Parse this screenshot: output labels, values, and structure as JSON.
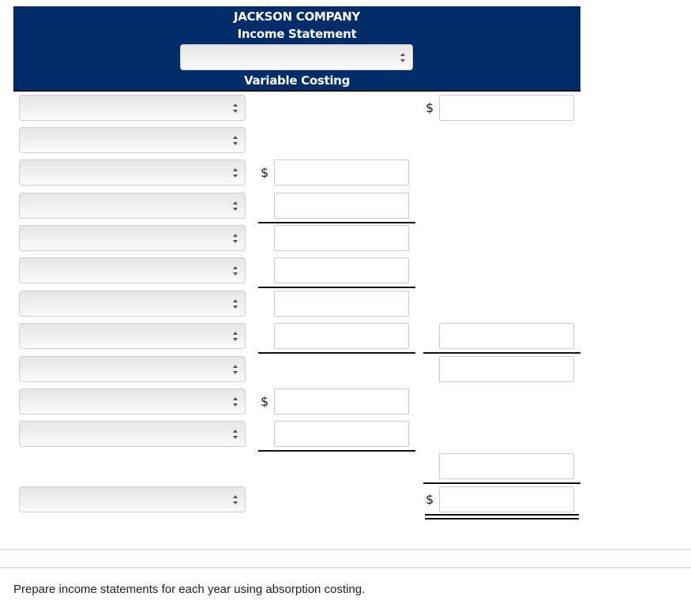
{
  "header": {
    "company": "JACKSON COMPANY",
    "statement": "Income Statement",
    "period_select": {
      "selected": ""
    },
    "method": "Variable Costing"
  },
  "currency_symbol": "$",
  "rows": [
    {
      "label_select": "",
      "mid": null,
      "right": "",
      "right_dollar": true
    },
    {
      "label_select": "",
      "mid": null,
      "right": null
    },
    {
      "label_select": "",
      "mid": "",
      "mid_dollar": true,
      "right": null
    },
    {
      "label_select": "",
      "mid": "",
      "right": null,
      "mid_underline": true
    },
    {
      "label_select": "",
      "mid": "",
      "right": null
    },
    {
      "label_select": "",
      "mid": "",
      "right": null,
      "mid_underline": true
    },
    {
      "label_select": "",
      "mid": "",
      "right": null
    },
    {
      "label_select": "",
      "mid": "",
      "right": "",
      "mid_underline": true,
      "right_underline": true
    },
    {
      "label_select": "",
      "mid": null,
      "right": ""
    },
    {
      "label_select": "",
      "mid": "",
      "mid_dollar": true,
      "right": null
    },
    {
      "label_select": "",
      "mid": "",
      "right": null,
      "mid_underline": true
    },
    {
      "label_select": null,
      "mid": null,
      "right": "",
      "right_underline": true
    },
    {
      "label_select": "",
      "mid": null,
      "right": "",
      "right_dollar": true,
      "right_double_underline": true
    }
  ],
  "instruction": "Prepare income statements for each year using absorption costing."
}
